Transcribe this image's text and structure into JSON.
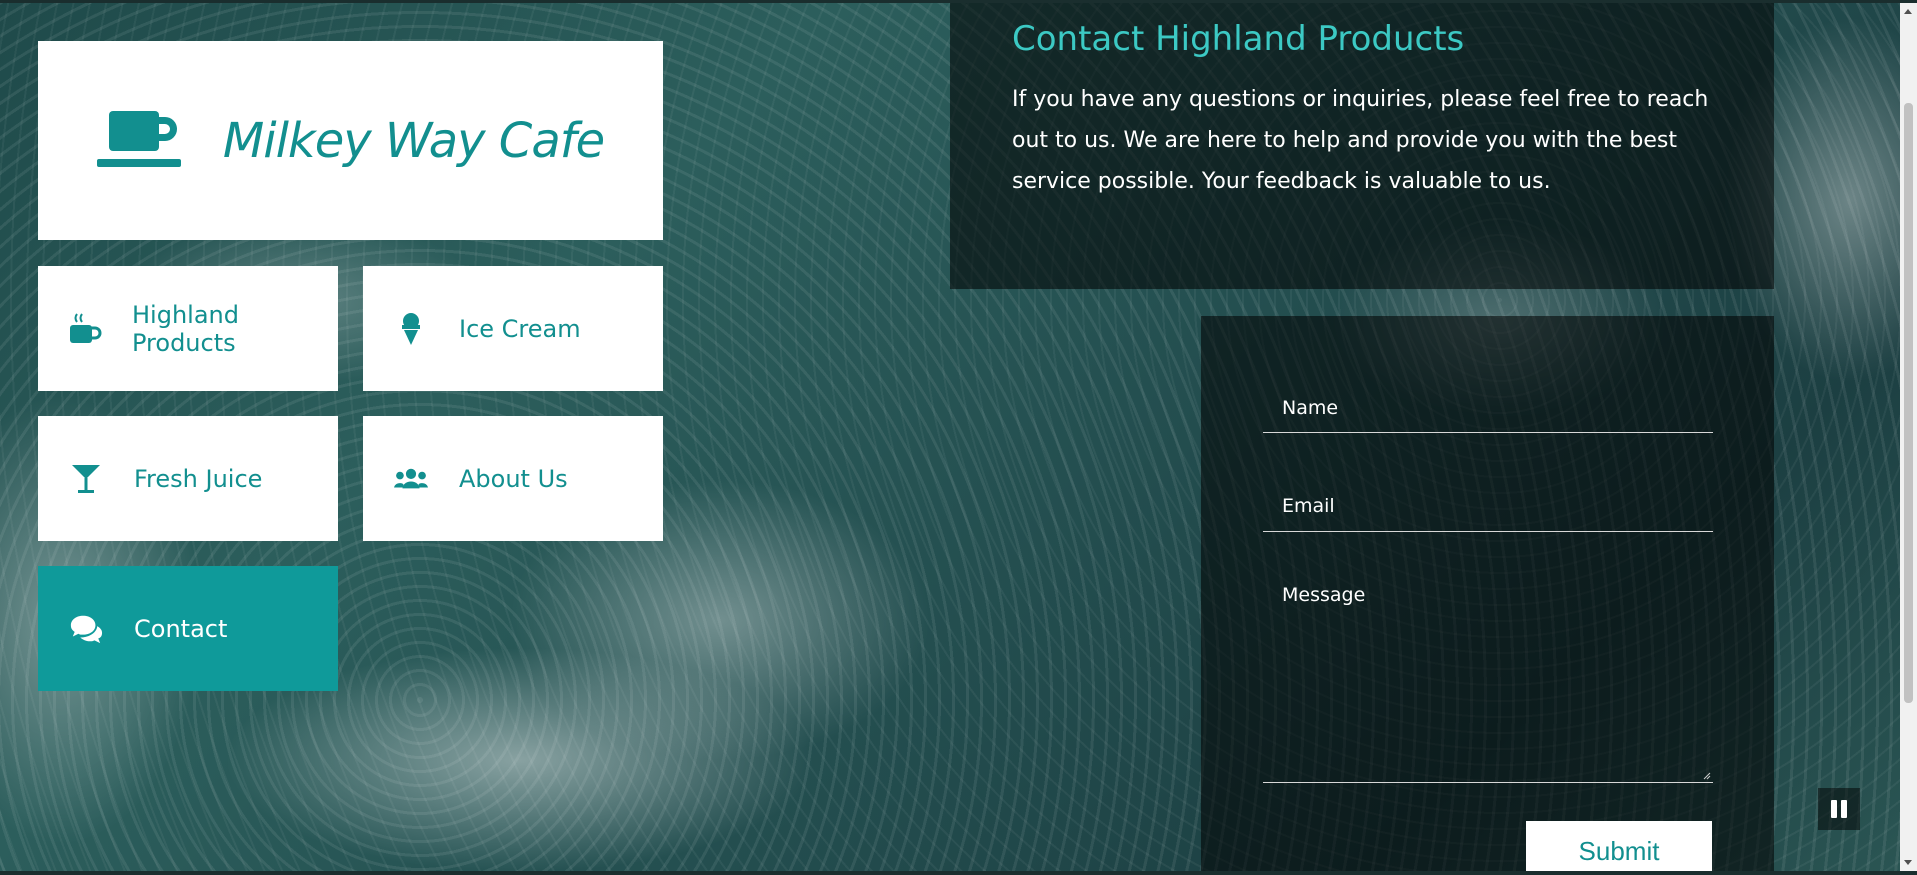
{
  "brand": {
    "title": "Milkey Way Cafe",
    "icon": "coffee-mug-icon"
  },
  "nav": {
    "items": [
      {
        "label": "Highland Products",
        "icon": "hot-beverage-icon"
      },
      {
        "label": "Ice Cream",
        "icon": "ice-cream-icon"
      },
      {
        "label": "Fresh Juice",
        "icon": "cocktail-glass-icon"
      },
      {
        "label": "About Us",
        "icon": "users-icon"
      },
      {
        "label": "Contact",
        "icon": "chat-bubbles-icon",
        "active": true
      }
    ]
  },
  "intro": {
    "title": "Contact Highland Products",
    "text": "If you have any questions or inquiries, please feel free to reach out to us. We are here to help and provide you with the best service possible. Your feedback is valuable to us."
  },
  "form": {
    "name_placeholder": "Name",
    "email_placeholder": "Email",
    "message_placeholder": "Message",
    "submit_label": "Submit"
  },
  "colors": {
    "accent": "#128f8f",
    "active_tile": "#0f9a9a",
    "heading": "#3cc9c4"
  },
  "video_control": {
    "icon": "pause-icon"
  }
}
